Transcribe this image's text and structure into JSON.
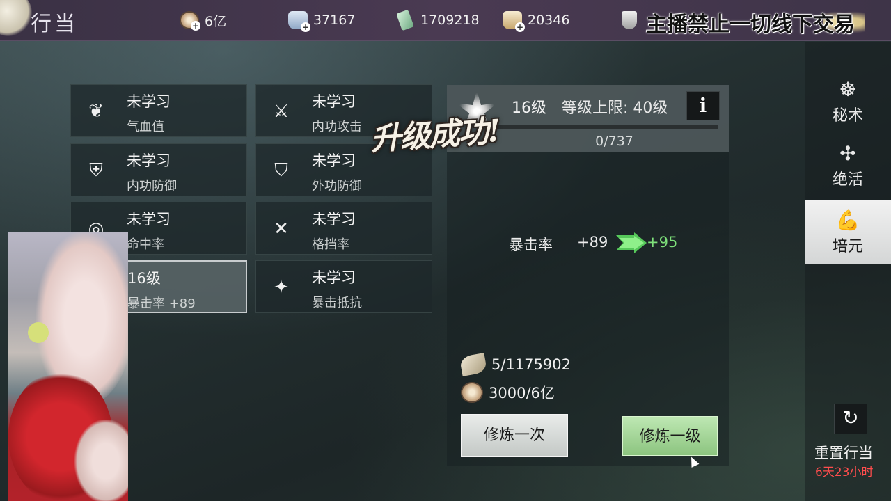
{
  "header": {
    "title": "行当",
    "overlay_notice": "主播禁止一切线下交易",
    "currencies": [
      {
        "icon": "coin-icon",
        "value": "6亿"
      },
      {
        "icon": "silver-ingot-icon",
        "value": "37167"
      },
      {
        "icon": "jade-icon",
        "value": "1709218"
      },
      {
        "icon": "gold-ingot-icon",
        "value": "20346"
      },
      {
        "icon": "badge-icon",
        "value": ""
      }
    ]
  },
  "skills": [
    {
      "status": "未学习",
      "attribute": "气血值",
      "icon": "heart-lotus-icon"
    },
    {
      "status": "未学习",
      "attribute": "内功攻击",
      "icon": "sword-icon"
    },
    {
      "status": "未学习",
      "attribute": "内功防御",
      "icon": "shield-icon"
    },
    {
      "status": "未学习",
      "attribute": "外功防御",
      "icon": "armor-shield-icon"
    },
    {
      "status": "未学习",
      "attribute": "命中率",
      "icon": "target-icon"
    },
    {
      "status": "未学习",
      "attribute": "格挡率",
      "icon": "crossed-swords-icon"
    },
    {
      "status": "16级",
      "attribute": "暴击率  +89",
      "icon": "crit-icon",
      "selected": true
    },
    {
      "status": "未学习",
      "attribute": "暴击抵抗",
      "icon": "crit-resist-icon"
    }
  ],
  "detail": {
    "level": "16级",
    "level_cap": "等级上限: 40级",
    "info_label": "i",
    "xp": "0/737",
    "xp_fraction": 0.0,
    "levelup_banner": "升级成功!",
    "stat_name": "暴击率",
    "stat_current": "+89",
    "stat_next": "+95",
    "costs": [
      {
        "icon": "leaf-icon",
        "value": "5/1175902"
      },
      {
        "icon": "coin-icon",
        "value": "3000/6亿"
      }
    ],
    "train_once_label": "修炼一次",
    "train_level_label": "修炼一级"
  },
  "nav": {
    "items": [
      {
        "label": "秘术",
        "icon": "scroll-icon",
        "active": false
      },
      {
        "label": "绝活",
        "icon": "crossbow-icon",
        "active": false
      },
      {
        "label": "培元",
        "icon": "muscle-icon",
        "active": true
      }
    ],
    "reset_label": "重置行当",
    "reset_timer": "6天23小时",
    "reset_icon": "refresh-icon"
  },
  "colors": {
    "accent_green": "#7ee07a",
    "timer_red": "#ff4d4d",
    "topbar": "#4a3a52"
  }
}
